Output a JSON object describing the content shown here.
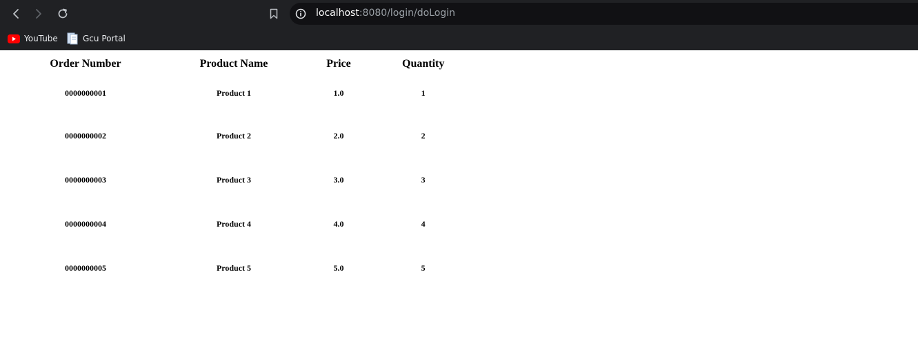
{
  "browser": {
    "url_host": "localhost",
    "url_rest": ":8080/login/doLogin",
    "bookmarks": [
      {
        "label": "YouTube",
        "icon": "youtube-icon"
      },
      {
        "label": "Gcu Portal",
        "icon": "folder-page-icon"
      }
    ]
  },
  "table": {
    "headers": [
      "Order Number",
      "Product Name",
      "Price",
      "Quantity"
    ],
    "rows": [
      [
        "0000000001",
        "Product 1",
        "1.0",
        "1"
      ],
      [
        "0000000002",
        "Product 2",
        "2.0",
        "2"
      ],
      [
        "0000000003",
        "Product 3",
        "3.0",
        "3"
      ],
      [
        "0000000004",
        "Product 4",
        "4.0",
        "4"
      ],
      [
        "0000000005",
        "Product 5",
        "5.0",
        "5"
      ]
    ]
  }
}
